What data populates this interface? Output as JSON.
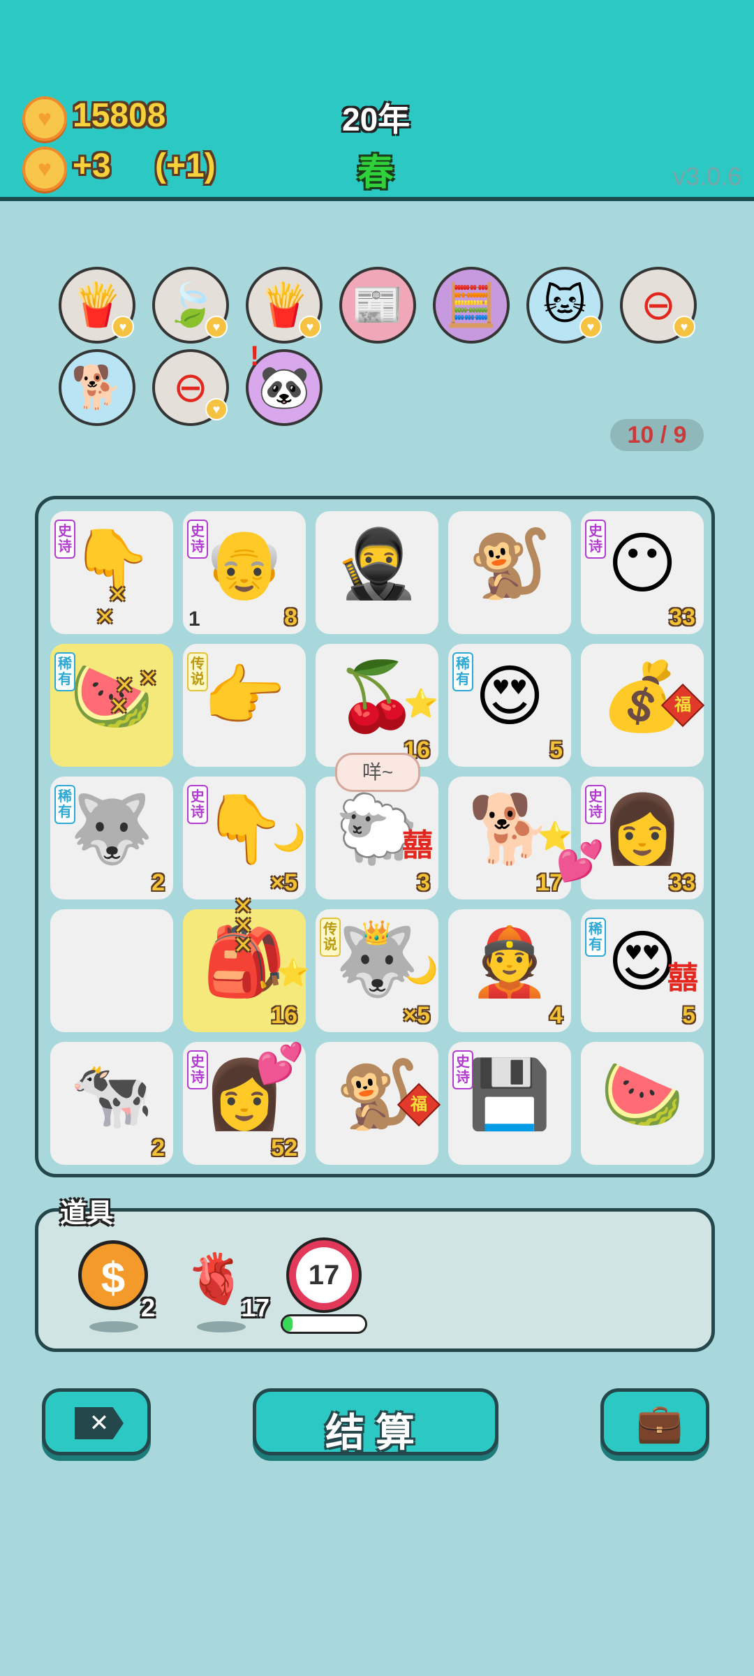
{
  "hud": {
    "coins": "15808",
    "income": "+3",
    "bonus": "(+1)",
    "year": "20年",
    "season": "春",
    "version": "v3.0.6"
  },
  "slots_row1": [
    "french-fries",
    "leaf",
    "french-fries",
    "time-magazine",
    "math-boy",
    "cat",
    "remove"
  ],
  "slots_row2": [
    "dog",
    "remove",
    "panda"
  ],
  "capacity": "10 / 9",
  "board": {
    "row1": [
      {
        "item": "pointing-hand",
        "tag": "史诗",
        "num": ""
      },
      {
        "item": "grandpa",
        "tag": "史诗",
        "num": "8",
        "left": "1"
      },
      {
        "item": "thief",
        "tag": "",
        "num": ""
      },
      {
        "item": "monkey",
        "tag": "",
        "num": ""
      },
      {
        "item": "yellow-ball",
        "tag": "史诗",
        "num": "33"
      }
    ],
    "row2": [
      {
        "item": "watermelon",
        "tag": "稀有",
        "num": ""
      },
      {
        "item": "yellow-hand",
        "tag": "传说",
        "num": ""
      },
      {
        "item": "cherry",
        "tag": "",
        "num": "16"
      },
      {
        "item": "lovestruck-man",
        "tag": "稀有",
        "num": "5"
      },
      {
        "item": "lucky-bag",
        "tag": "",
        "num": ""
      }
    ],
    "row3": [
      {
        "item": "husky",
        "tag": "稀有",
        "num": "2"
      },
      {
        "item": "pointing-hand",
        "tag": "史诗",
        "num": "×5"
      },
      {
        "item": "sheep",
        "tag": "",
        "num": "3",
        "bubble": "咩~"
      },
      {
        "item": "dog",
        "tag": "",
        "num": "17"
      },
      {
        "item": "girl",
        "tag": "史诗",
        "num": "33"
      }
    ],
    "row4": [
      {
        "item": "empty",
        "tag": "",
        "num": ""
      },
      {
        "item": "bag",
        "tag": "",
        "num": "16"
      },
      {
        "item": "husky-king",
        "tag": "传说",
        "num": "×5"
      },
      {
        "item": "old-man",
        "tag": "",
        "num": "4"
      },
      {
        "item": "lovestruck-man",
        "tag": "稀有",
        "num": "5"
      }
    ],
    "row5": [
      {
        "item": "cow",
        "tag": "",
        "num": "2"
      },
      {
        "item": "girl",
        "tag": "史诗",
        "num": "52"
      },
      {
        "item": "monkey",
        "tag": "",
        "num": ""
      },
      {
        "item": "gpu",
        "tag": "史诗",
        "num": ""
      },
      {
        "item": "watermelon",
        "tag": "",
        "num": ""
      }
    ]
  },
  "props": {
    "title": "道具",
    "coin_count": "2",
    "liver_count": "17",
    "timer_value": "17",
    "timer_progress": 0.12
  },
  "buttons": {
    "exit_label": "✕",
    "settle_label": "结算",
    "bag_label": ""
  },
  "colors": {
    "top_bar": "#2cc8c4",
    "background": "#a9d8dc",
    "number": "#f3c335"
  }
}
